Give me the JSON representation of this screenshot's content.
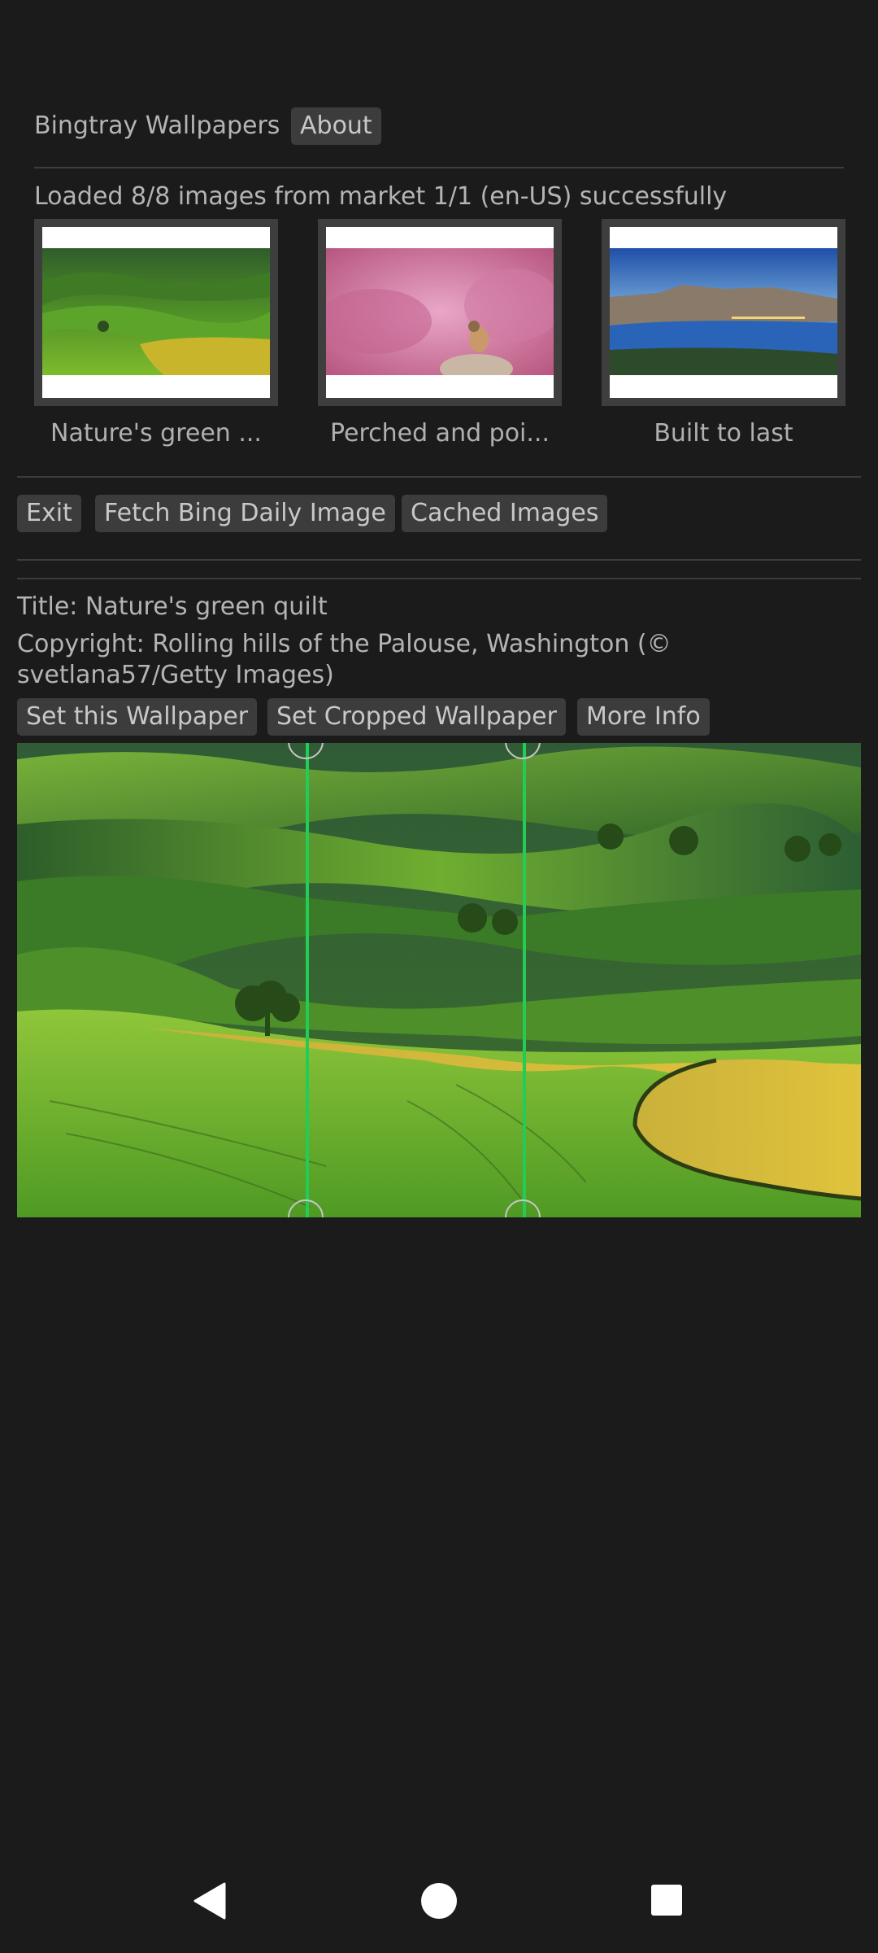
{
  "header": {
    "app_title": "Bingtray Wallpapers",
    "about_label": "About"
  },
  "status": {
    "message": "Loaded 8/8 images from market 1/1 (en-US) successfully"
  },
  "thumbnails": [
    {
      "caption": "Nature's green ..."
    },
    {
      "caption": "Perched and poi..."
    },
    {
      "caption": "Built to last"
    }
  ],
  "toolbar": {
    "exit_label": "Exit",
    "fetch_label": "Fetch Bing Daily Image",
    "cached_label": "Cached Images"
  },
  "detail": {
    "title": "Title: Nature's green quilt",
    "copyright_line1": "Copyright: Rolling hills of the Palouse, Washington (©",
    "copyright_line2": "svetlana57/Getty Images)",
    "set_wallpaper_label": "Set this Wallpaper",
    "set_cropped_label": "Set Cropped Wallpaper",
    "more_info_label": "More Info"
  },
  "colors": {
    "background": "#1b1b1b",
    "button_bg": "#3c3c3c",
    "crop_line": "#22cc55"
  },
  "icons": {
    "back": "back-triangle-icon",
    "home": "home-circle-icon",
    "recents": "recents-square-icon"
  }
}
